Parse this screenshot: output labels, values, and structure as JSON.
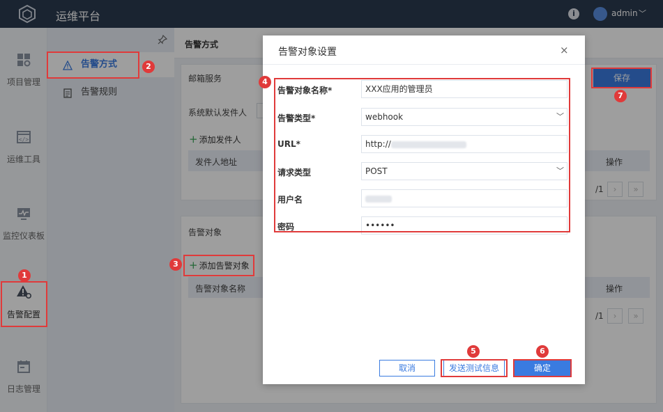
{
  "app": {
    "title": "运维平台"
  },
  "header": {
    "user_name": "admin",
    "info_icon": "i"
  },
  "left_nav": [
    {
      "label": "项目管理",
      "icon": "grid-icon"
    },
    {
      "label": "运维工具",
      "icon": "code-window-icon"
    },
    {
      "label": "监控仪表板",
      "icon": "monitor-icon"
    },
    {
      "label": "告警配置",
      "icon": "alert-gear-icon"
    },
    {
      "label": "日志管理",
      "icon": "calendar-icon"
    }
  ],
  "sub_nav": [
    {
      "label": "告警方式",
      "icon": "warning-triangle-icon"
    },
    {
      "label": "告警规则",
      "icon": "document-icon"
    }
  ],
  "main": {
    "header_title": "告警方式",
    "mail_section": {
      "title": "邮箱服务",
      "default_sender_label": "系统默认发件人",
      "add_sender": "添加发件人",
      "columns": [
        "发件人地址",
        "操作"
      ],
      "pager_total": "/1"
    },
    "target_section": {
      "title": "告警对象",
      "add_target": "添加告警对象",
      "columns": [
        "告警对象名称",
        "操作"
      ],
      "pager_total": "/1"
    },
    "save_label": "保存"
  },
  "modal": {
    "title": "告警对象设置",
    "close": "×",
    "fields": [
      {
        "label": "告警对象名称*",
        "value": "XXX应用的管理员"
      },
      {
        "label": "告警类型*",
        "value": "webhook"
      },
      {
        "label": "URL*",
        "value": "http://"
      },
      {
        "label": "请求类型",
        "value": "POST"
      },
      {
        "label": "用户名",
        "value": ""
      },
      {
        "label": "密码",
        "value": "••••••"
      }
    ],
    "cancel_label": "取消",
    "test_label": "发送测试信息",
    "confirm_label": "确定"
  },
  "annotations": [
    "1",
    "2",
    "3",
    "4",
    "5",
    "6",
    "7"
  ],
  "colors": {
    "accent": "#3a7be0",
    "highlight": "#e03a3a",
    "topbar": "#2b3a4f"
  }
}
